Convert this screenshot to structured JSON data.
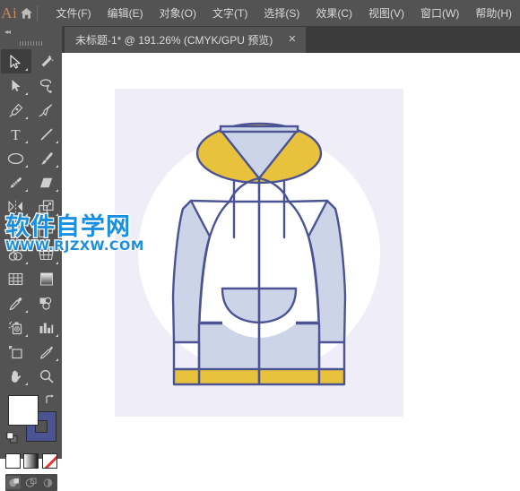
{
  "app": {
    "logo_text": "Ai",
    "home_icon": "home-icon"
  },
  "menubar": {
    "items": [
      {
        "label": "文件(F)",
        "name": "menu-file"
      },
      {
        "label": "编辑(E)",
        "name": "menu-edit"
      },
      {
        "label": "对象(O)",
        "name": "menu-object"
      },
      {
        "label": "文字(T)",
        "name": "menu-type"
      },
      {
        "label": "选择(S)",
        "name": "menu-select"
      },
      {
        "label": "效果(C)",
        "name": "menu-effect"
      },
      {
        "label": "视图(V)",
        "name": "menu-view"
      },
      {
        "label": "窗口(W)",
        "name": "menu-window"
      },
      {
        "label": "帮助(H)",
        "name": "menu-help"
      }
    ]
  },
  "tabbar": {
    "document_title": "未标题-1* @ 191.26% (CMYK/GPU 预览)",
    "close_label": "✕"
  },
  "toolbar": {
    "collapse_label": "◂◂",
    "tools": [
      {
        "name": "selection-tool-icon",
        "label": "选择工具",
        "selected": true,
        "corner": true
      },
      {
        "name": "magic-wand-tool-icon",
        "label": "魔棒工具",
        "selected": false,
        "corner": false
      },
      {
        "name": "direct-selection-tool-icon",
        "label": "直接选择工具",
        "selected": false,
        "corner": true
      },
      {
        "name": "lasso-tool-icon",
        "label": "套索工具",
        "selected": false,
        "corner": false
      },
      {
        "name": "pen-tool-icon",
        "label": "钢笔工具",
        "selected": false,
        "corner": true
      },
      {
        "name": "curvature-tool-icon",
        "label": "曲率工具",
        "selected": false,
        "corner": false
      },
      {
        "name": "type-tool-icon",
        "label": "文字工具",
        "selected": false,
        "corner": true
      },
      {
        "name": "line-segment-tool-icon",
        "label": "直线段工具",
        "selected": false,
        "corner": true
      },
      {
        "name": "ellipse-tool-icon",
        "label": "椭圆工具",
        "selected": false,
        "corner": true
      },
      {
        "name": "paintbrush-tool-icon",
        "label": "画笔工具",
        "selected": false,
        "corner": true
      },
      {
        "name": "shaper-pencil-tool-icon",
        "label": "Shaper 工具",
        "selected": false,
        "corner": true
      },
      {
        "name": "eraser-tool-icon",
        "label": "橡皮擦工具",
        "selected": false,
        "corner": true
      },
      {
        "name": "rotate-reflect-tool-icon",
        "label": "旋转工具",
        "selected": false,
        "corner": true
      },
      {
        "name": "scale-tool-icon",
        "label": "比例缩放工具",
        "selected": false,
        "corner": true
      },
      {
        "name": "width-tool-icon",
        "label": "宽度工具",
        "selected": false,
        "corner": true
      },
      {
        "name": "free-transform-tool-icon",
        "label": "自由变换工具",
        "selected": false,
        "corner": false
      },
      {
        "name": "shape-builder-tool-icon",
        "label": "形状生成器工具",
        "selected": false,
        "corner": true
      },
      {
        "name": "perspective-grid-tool-icon",
        "label": "透视网格工具",
        "selected": false,
        "corner": true
      },
      {
        "name": "mesh-tool-icon",
        "label": "网格工具",
        "selected": false,
        "corner": false
      },
      {
        "name": "gradient-tool-icon",
        "label": "渐变工具",
        "selected": false,
        "corner": false
      },
      {
        "name": "eyedropper-tool-icon",
        "label": "吸管工具",
        "selected": false,
        "corner": true
      },
      {
        "name": "blend-tool-icon",
        "label": "混合工具",
        "selected": false,
        "corner": false
      },
      {
        "name": "symbol-sprayer-tool-icon",
        "label": "符号喷枪工具",
        "selected": false,
        "corner": true
      },
      {
        "name": "column-graph-tool-icon",
        "label": "柱形图工具",
        "selected": false,
        "corner": true
      },
      {
        "name": "artboard-tool-icon",
        "label": "画板工具",
        "selected": false,
        "corner": false
      },
      {
        "name": "slice-tool-icon",
        "label": "切片工具",
        "selected": false,
        "corner": true
      },
      {
        "name": "hand-tool-icon",
        "label": "抓手工具",
        "selected": false,
        "corner": true
      },
      {
        "name": "zoom-tool-icon",
        "label": "缩放工具",
        "selected": false,
        "corner": false
      }
    ],
    "fill_color": "#ffffff",
    "stroke_color": "#4a5495",
    "fill_label": "填色",
    "stroke_label": "描边",
    "swap_label": "互换填色和描边",
    "default_label": "默认填色和描边",
    "paint_modes": [
      {
        "name": "color-swatch-button",
        "label": "颜色",
        "active": true
      },
      {
        "name": "gradient-swatch-button",
        "label": "渐变",
        "active": false
      },
      {
        "name": "none-swatch-button",
        "label": "无",
        "active": false
      }
    ],
    "draw_modes": [
      {
        "name": "draw-normal-button",
        "label": "正常绘图",
        "active": true
      },
      {
        "name": "draw-behind-button",
        "label": "背面绘图",
        "active": false
      },
      {
        "name": "draw-inside-button",
        "label": "内部绘图",
        "active": false
      }
    ]
  },
  "canvas": {
    "artboard_background": "#eeedf8",
    "artwork_name": "hoodie-illustration",
    "artwork_colors": {
      "circle": "#ffffff",
      "body": "#ffffff",
      "sleeve": "#ccd5e8",
      "accent": "#e8c23c",
      "outline": "#4a5495"
    }
  },
  "watermark": {
    "main": "软件自学网",
    "sub": "WWW.RJZXW.COM"
  }
}
